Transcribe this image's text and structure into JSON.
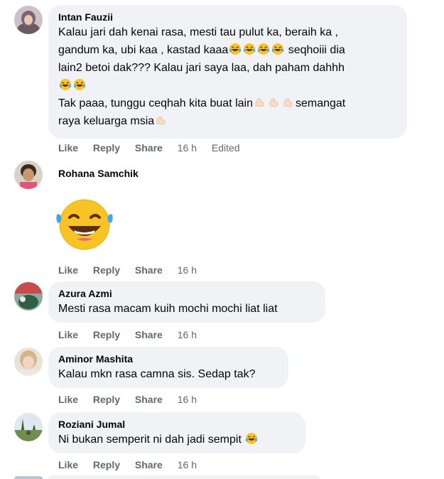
{
  "comments": [
    {
      "author": "Intan Fauzii",
      "lines": [
        "Kalau jari dah kenai rasa, mesti tau pulut ka, beraih ka ,",
        "gandum ka, ubi kaa , kastad kaaa",
        "seqhoiii dia",
        "lain2 betoi dak??? Kalau jari saya laa, dah paham dahhh",
        "Tak paaa, tunggu ceqhah kita buat lain",
        "semangat",
        "raya keluarga msia"
      ],
      "actions": {
        "like": "Like",
        "reply": "Reply",
        "share": "Share",
        "time": "16 h",
        "edited": "Edited"
      }
    },
    {
      "author": "Rohana Samchik",
      "sticker": "laughing-tears-emoji",
      "actions": {
        "like": "Like",
        "reply": "Reply",
        "share": "Share",
        "time": "16 h"
      }
    },
    {
      "author": "Azura Azmi",
      "text": "Mesti rasa macam kuih mochi mochi liat liat",
      "actions": {
        "like": "Like",
        "reply": "Reply",
        "share": "Share",
        "time": "16 h"
      }
    },
    {
      "author": "Aminor Mashita",
      "text": "Kalau mkn rasa camna sis. Sedap tak?",
      "actions": {
        "like": "Like",
        "reply": "Reply",
        "share": "Share",
        "time": "16 h"
      }
    },
    {
      "author": "Roziani Jumal",
      "text": "Ni bukan semperit ni dah jadi sempit",
      "actions": {
        "like": "Like",
        "reply": "Reply",
        "share": "Share",
        "time": "16 h"
      }
    }
  ],
  "colors": {
    "bubble": "#f0f2f5",
    "meta": "#65676b",
    "text": "#050505"
  }
}
